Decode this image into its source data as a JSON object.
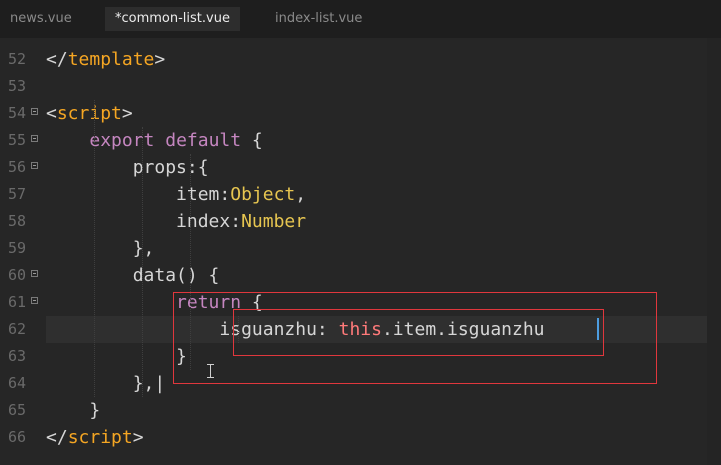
{
  "tabs": [
    {
      "label": "news.vue",
      "active": false
    },
    {
      "label": "*common-list.vue",
      "active": true
    },
    {
      "label": "index-list.vue",
      "active": false
    }
  ],
  "lines": [
    {
      "n": "52",
      "fold": false,
      "tokens": [
        [
          "punc",
          "</"
        ],
        [
          "tag",
          "template"
        ],
        [
          "punc",
          ">"
        ]
      ]
    },
    {
      "n": "53",
      "fold": false,
      "tokens": []
    },
    {
      "n": "54",
      "fold": true,
      "tokens": [
        [
          "punc",
          "<"
        ],
        [
          "tag",
          "script"
        ],
        [
          "punc",
          ">"
        ]
      ]
    },
    {
      "n": "55",
      "fold": true,
      "tokens": [
        [
          "punc",
          "    "
        ],
        [
          "kw",
          "export"
        ],
        [
          "punc",
          " "
        ],
        [
          "kw",
          "default"
        ],
        [
          "punc",
          " {"
        ]
      ]
    },
    {
      "n": "56",
      "fold": true,
      "tokens": [
        [
          "punc",
          "        props:{"
        ]
      ]
    },
    {
      "n": "57",
      "fold": false,
      "tokens": [
        [
          "punc",
          "            item:"
        ],
        [
          "ty",
          "Object"
        ],
        [
          "punc",
          ","
        ]
      ]
    },
    {
      "n": "58",
      "fold": false,
      "tokens": [
        [
          "punc",
          "            index:"
        ],
        [
          "ty",
          "Number"
        ]
      ]
    },
    {
      "n": "59",
      "fold": false,
      "tokens": [
        [
          "punc",
          "        },"
        ]
      ]
    },
    {
      "n": "60",
      "fold": true,
      "tokens": [
        [
          "punc",
          "        data() {"
        ]
      ]
    },
    {
      "n": "61",
      "fold": true,
      "tokens": [
        [
          "punc",
          "            "
        ],
        [
          "kw",
          "return"
        ],
        [
          "punc",
          " {"
        ]
      ]
    },
    {
      "n": "62",
      "fold": false,
      "tokens": [
        [
          "punc",
          "                isguanzhu: "
        ],
        [
          "th",
          "this"
        ],
        [
          "punc",
          ".item.isguanzhu"
        ]
      ]
    },
    {
      "n": "63",
      "fold": false,
      "tokens": [
        [
          "punc",
          "            }"
        ]
      ]
    },
    {
      "n": "64",
      "fold": false,
      "tokens": [
        [
          "punc",
          "        },|"
        ]
      ]
    },
    {
      "n": "65",
      "fold": false,
      "tokens": [
        [
          "punc",
          "    }"
        ]
      ]
    },
    {
      "n": "66",
      "fold": false,
      "tokens": [
        [
          "punc",
          "</"
        ],
        [
          "tag",
          "script"
        ],
        [
          "punc",
          ">"
        ]
      ]
    }
  ],
  "colors": {
    "tag": "#f5a623",
    "keyword": "#c586c0",
    "type": "#e6c550",
    "this": "#ff7a7a",
    "annotation": "#e0373d"
  }
}
